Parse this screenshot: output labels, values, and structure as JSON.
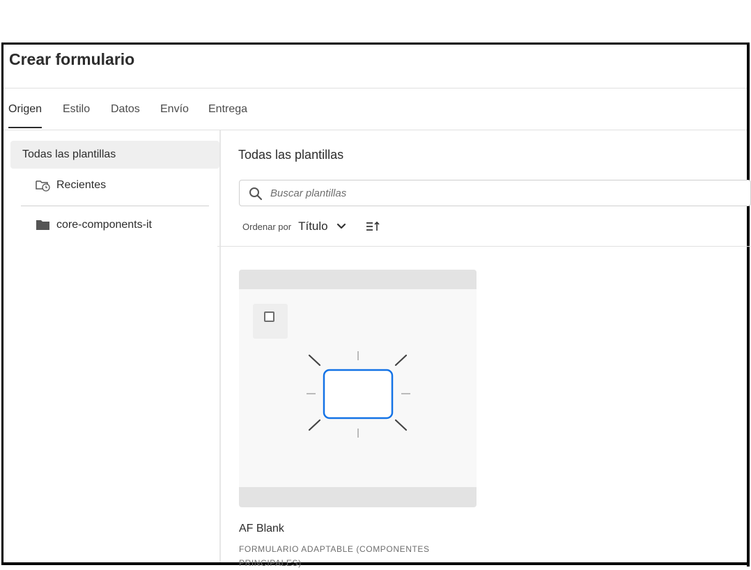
{
  "header": {
    "title": "Crear formulario"
  },
  "tabs": [
    {
      "label": "Origen",
      "active": true
    },
    {
      "label": "Estilo"
    },
    {
      "label": "Datos"
    },
    {
      "label": "Envío"
    },
    {
      "label": "Entrega"
    }
  ],
  "sidebar": {
    "all_label": "Todas las plantillas",
    "items": [
      {
        "label": "Recientes",
        "icon": "recent-folder-icon"
      },
      {
        "label": "core-components-it",
        "icon": "folder-icon"
      }
    ]
  },
  "main": {
    "title": "Todas las plantillas",
    "search": {
      "placeholder": "Buscar plantillas",
      "icon": "search-icon"
    },
    "sort": {
      "label": "Ordenar por",
      "value": "Título",
      "icons": [
        "chevron-down-icon",
        "sort-direction-icon"
      ]
    }
  },
  "cards": [
    {
      "name": "AF Blank",
      "type": "FORMULARIO ADAPTABLE (COMPONENTES PRINCIPALES)",
      "icon": "blank-form-icon"
    }
  ],
  "colors": {
    "accent": "#1473e6",
    "text": "#2c2c2c",
    "selected_bg": "#efefef"
  }
}
